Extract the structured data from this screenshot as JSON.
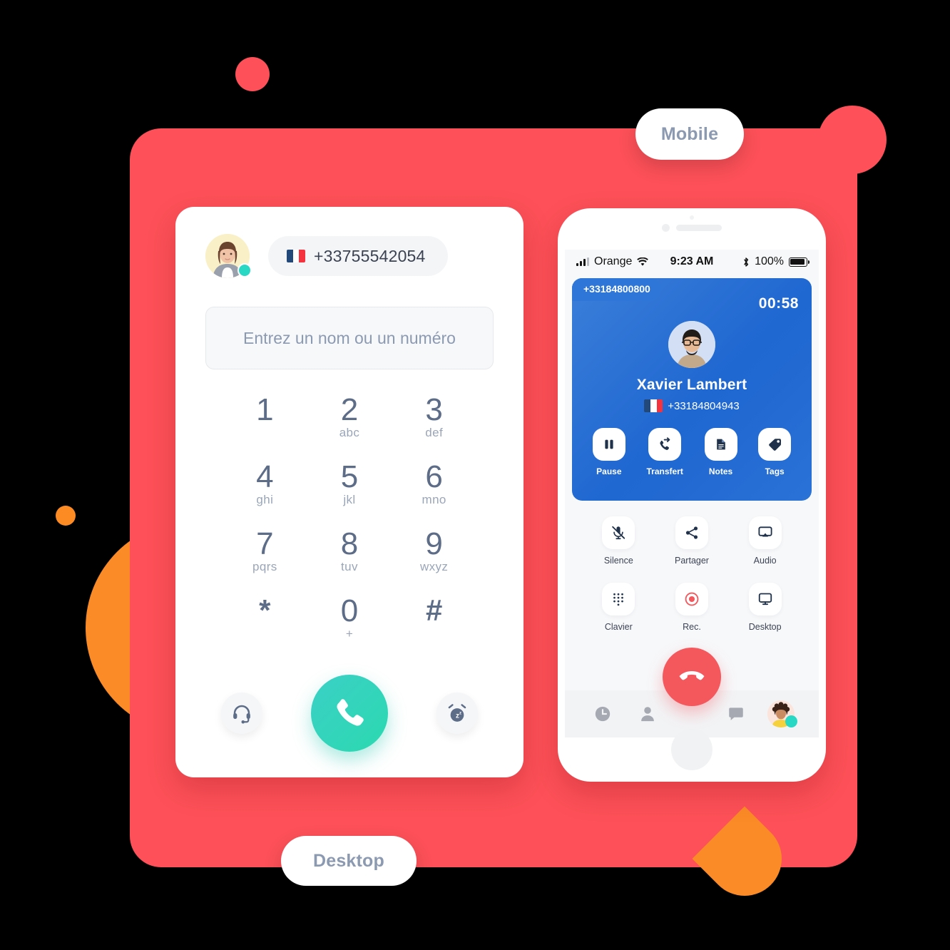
{
  "labels": {
    "mobile": "Mobile",
    "desktop": "Desktop"
  },
  "desktop_app": {
    "user_avatar_alt": "user-avatar",
    "user_status": "online",
    "my_number": "+33755542054",
    "my_number_country": "FR",
    "search_placeholder": "Entrez un nom ou un numéro",
    "dialpad": [
      {
        "digit": "1",
        "letters": ""
      },
      {
        "digit": "2",
        "letters": "abc"
      },
      {
        "digit": "3",
        "letters": "def"
      },
      {
        "digit": "4",
        "letters": "ghi"
      },
      {
        "digit": "5",
        "letters": "jkl"
      },
      {
        "digit": "6",
        "letters": "mno"
      },
      {
        "digit": "7",
        "letters": "pqrs"
      },
      {
        "digit": "8",
        "letters": "tuv"
      },
      {
        "digit": "9",
        "letters": "wxyz"
      },
      {
        "digit": "*",
        "letters": ""
      },
      {
        "digit": "0",
        "letters": "+"
      },
      {
        "digit": "#",
        "letters": ""
      }
    ],
    "actions": {
      "headset": "headset-icon",
      "call": "call-icon",
      "snooze": "snooze-alarm-icon"
    }
  },
  "phone": {
    "status_bar": {
      "carrier": "Orange",
      "time": "9:23 AM",
      "battery": "100%",
      "signal_icon": "signal-bars-icon",
      "wifi_icon": "wifi-icon",
      "bluetooth_icon": "bluetooth-icon",
      "battery_icon": "battery-full-icon"
    },
    "call_card": {
      "did_number": "+33184800800",
      "timer": "00:58",
      "caller_name": "Xavier Lambert",
      "caller_number": "+33184804943",
      "caller_country": "FR",
      "actions": [
        {
          "label": "Pause",
          "icon": "pause-icon"
        },
        {
          "label": "Transfert",
          "icon": "call-transfer-icon"
        },
        {
          "label": "Notes",
          "icon": "document-icon"
        },
        {
          "label": "Tags",
          "icon": "tag-icon"
        }
      ]
    },
    "controls": [
      {
        "label": "Silence",
        "icon": "microphone-muted-icon"
      },
      {
        "label": "Partager",
        "icon": "share-icon"
      },
      {
        "label": "Audio",
        "icon": "airplay-audio-icon"
      },
      {
        "label": "Clavier",
        "icon": "keypad-icon"
      },
      {
        "label": "Rec.",
        "icon": "record-icon"
      },
      {
        "label": "Desktop",
        "icon": "monitor-icon"
      }
    ],
    "tabbar": [
      {
        "icon": "history-clock-icon"
      },
      {
        "icon": "contact-person-icon"
      },
      {
        "icon": "hangup-icon"
      },
      {
        "icon": "chat-bubble-icon"
      },
      {
        "icon": "profile-avatar-icon"
      }
    ]
  },
  "colors": {
    "brand_red": "#FD5058",
    "orange": "#FB8B26",
    "blue": "#2A72D6",
    "teal": "#28D8C4",
    "hangup_red": "#F4575C",
    "text_slate": "#5D6C87"
  }
}
